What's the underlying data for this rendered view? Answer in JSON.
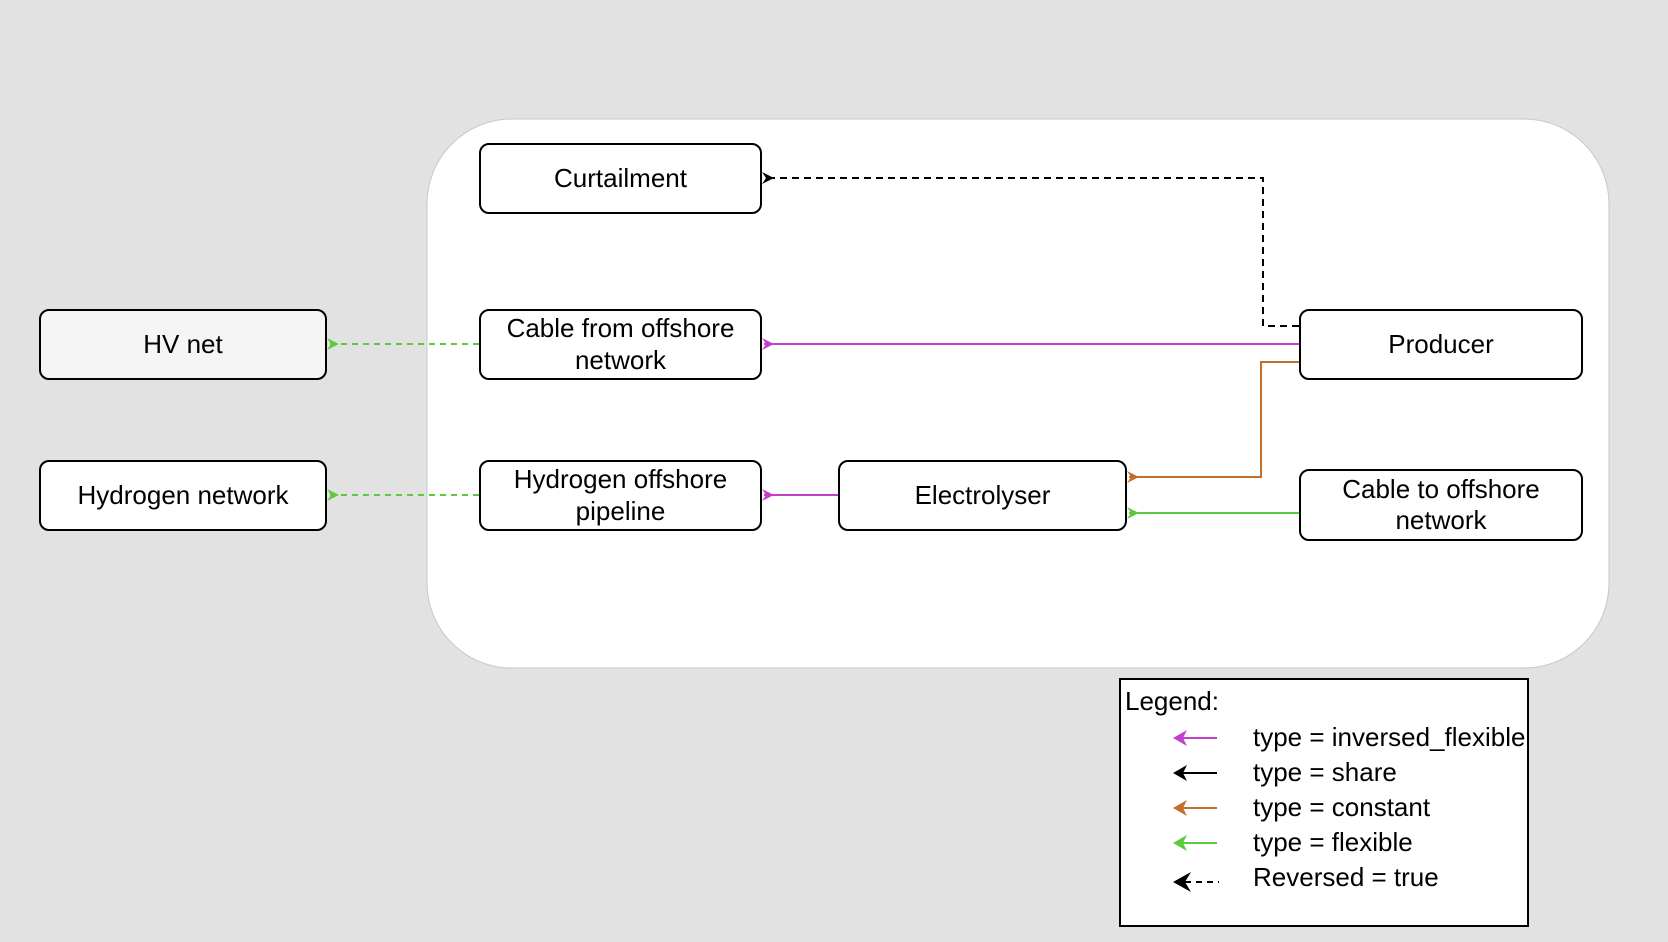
{
  "nodes": {
    "curtailment": "Curtailment",
    "cable_from": "Cable from offshore network",
    "hydrogen_pipeline": "Hydrogen offshore pipeline",
    "hv_net": "HV net",
    "hydrogen_network": "Hydrogen network",
    "electrolyser": "Electrolyser",
    "producer": "Producer",
    "cable_to": "Cable to offshore network"
  },
  "legend": {
    "title": "Legend:",
    "items": [
      {
        "label": "type = inversed_flexible",
        "color": "#c13fcb",
        "style": "solid"
      },
      {
        "label": "type = share",
        "color": "#000000",
        "style": "solid"
      },
      {
        "label": "type = constant",
        "color": "#c0702b",
        "style": "solid"
      },
      {
        "label": "type = flexible",
        "color": "#5cc93e",
        "style": "solid"
      },
      {
        "label": "Reversed = true",
        "color": "#000000",
        "style": "dashed"
      }
    ]
  },
  "edges": [
    {
      "from": "producer",
      "to": "curtailment",
      "type": "share",
      "reversed": true
    },
    {
      "from": "producer",
      "to": "cable_from",
      "type": "inversed_flexible"
    },
    {
      "from": "producer",
      "to": "electrolyser",
      "type": "constant"
    },
    {
      "from": "cable_to",
      "to": "electrolyser",
      "type": "flexible"
    },
    {
      "from": "electrolyser",
      "to": "hydrogen_pipeline",
      "type": "inversed_flexible"
    },
    {
      "from": "cable_from",
      "to": "hv_net",
      "type": "flexible",
      "reversed": true
    },
    {
      "from": "hydrogen_pipeline",
      "to": "hydrogen_network",
      "type": "flexible",
      "reversed": true
    }
  ]
}
